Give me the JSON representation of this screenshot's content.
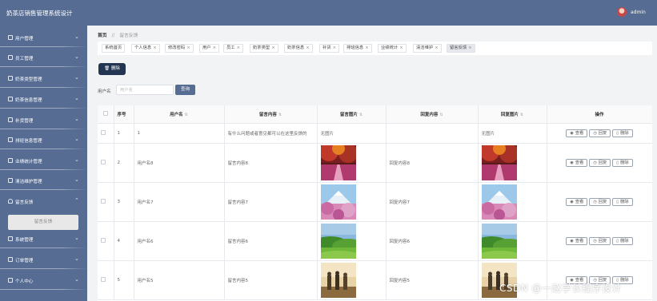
{
  "header": {
    "title": "奶茶店销售管理系统设计",
    "user": "admin"
  },
  "sidebar": {
    "items": [
      {
        "label": "用户管理"
      },
      {
        "label": "员工管理"
      },
      {
        "label": "奶茶类型管理"
      },
      {
        "label": "奶茶信息管理"
      },
      {
        "label": "补货管理"
      },
      {
        "label": "排班信息管理"
      },
      {
        "label": "业绩统计管理"
      },
      {
        "label": "清洁维护管理"
      },
      {
        "label": "留言反馈"
      },
      {
        "label": "系统管理"
      },
      {
        "label": "订单管理"
      },
      {
        "label": "个人中心"
      }
    ],
    "sub_item": "留言反馈"
  },
  "breadcrumb": {
    "home": "首页",
    "separator": "//",
    "current": "留言反馈"
  },
  "tabs": [
    {
      "label": "系统首页",
      "closable": false
    },
    {
      "label": "个人信息",
      "closable": true
    },
    {
      "label": "修改密码",
      "closable": true
    },
    {
      "label": "用户",
      "closable": true
    },
    {
      "label": "员工",
      "closable": true
    },
    {
      "label": "奶茶类型",
      "closable": true
    },
    {
      "label": "奶茶信息",
      "closable": true
    },
    {
      "label": "补货",
      "closable": true
    },
    {
      "label": "排班信息",
      "closable": true
    },
    {
      "label": "业绩统计",
      "closable": true
    },
    {
      "label": "清洁维护",
      "closable": true
    },
    {
      "label": "留言反馈",
      "closable": true
    }
  ],
  "toolbar": {
    "delete_label": "删除"
  },
  "search": {
    "label": "用户名",
    "placeholder": "用户名",
    "button": "查询"
  },
  "table": {
    "columns": [
      "序号",
      "用户名",
      "留言内容",
      "留言图片",
      "回复内容",
      "回复图片",
      "操作"
    ],
    "rows": [
      {
        "index": "1",
        "username": "1",
        "content": "有什么问题或者意见都可以在这里反馈的",
        "image": "无图片",
        "reply": "",
        "reply_image": "无图片",
        "scene": "none"
      },
      {
        "index": "2",
        "username": "用户名8",
        "content": "留言内容8",
        "image": "",
        "reply": "回复内容8",
        "reply_image": "",
        "scene": "autumn-road"
      },
      {
        "index": "3",
        "username": "用户名7",
        "content": "留言内容7",
        "image": "",
        "reply": "回复内容7",
        "reply_image": "",
        "scene": "cherry-mountain"
      },
      {
        "index": "4",
        "username": "用户名6",
        "content": "留言内容6",
        "image": "",
        "reply": "回复内容6",
        "reply_image": "",
        "scene": "green-hills"
      },
      {
        "index": "5",
        "username": "用户名5",
        "content": "留言内容5",
        "image": "",
        "reply": "回复内容5",
        "reply_image": "",
        "scene": "hikers"
      }
    ],
    "actions": {
      "view": "查看",
      "reply": "回复",
      "delete": "删除"
    }
  },
  "watermark": "CSDN @一赵学长程序设计",
  "colors": {
    "sidebar": "#566c93",
    "topbar": "#566c93",
    "primary_dark": "#243551"
  }
}
